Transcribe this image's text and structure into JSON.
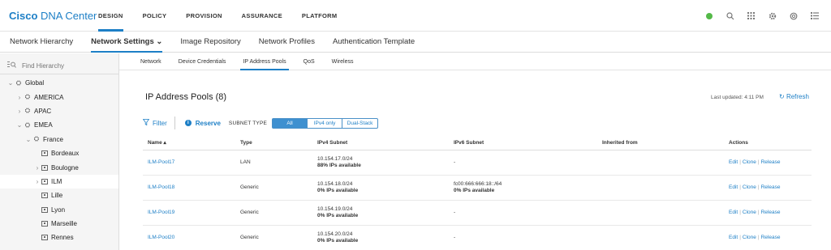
{
  "app": {
    "brand_bold": "Cisco",
    "brand_rest": " DNA Center",
    "topnav": [
      "DESIGN",
      "POLICY",
      "PROVISION",
      "ASSURANCE",
      "PLATFORM"
    ],
    "active_topnav": "DESIGN",
    "icons": [
      "status-icon",
      "search-icon",
      "apps-grid-icon",
      "gear-icon",
      "help-icon",
      "menu-icon"
    ],
    "colors": {
      "accent": "#1d7fc6",
      "status_ok": "#54b948"
    }
  },
  "subnav": {
    "items": [
      "Network Hierarchy",
      "Network Settings ⌄",
      "Image Repository",
      "Network Profiles",
      "Authentication Template"
    ]
  },
  "sidebar": {
    "search_placeholder": "Find Hierarchy",
    "tree": [
      {
        "label": "Global",
        "chev": "⌄",
        "icon": "globe"
      },
      {
        "label": "AMERICA",
        "chev": "›",
        "icon": "globe"
      },
      {
        "label": "APAC",
        "chev": "›",
        "icon": "globe"
      },
      {
        "label": "EMEA",
        "chev": "⌄",
        "icon": "globe"
      },
      {
        "label": "France",
        "chev": "⌄",
        "icon": "globe"
      },
      {
        "label": "Bordeaux",
        "chev": "",
        "icon": "building"
      },
      {
        "label": "Boulogne",
        "chev": "›",
        "icon": "building"
      },
      {
        "label": "ILM",
        "chev": "›",
        "icon": "building"
      },
      {
        "label": "Lille",
        "chev": "",
        "icon": "building"
      },
      {
        "label": "Lyon",
        "chev": "",
        "icon": "building"
      },
      {
        "label": "Marseille",
        "chev": "",
        "icon": "building"
      },
      {
        "label": "Rennes",
        "chev": "",
        "icon": "building"
      }
    ]
  },
  "tabs": [
    "Network",
    "Device Credentials",
    "IP Address Pools",
    "QoS",
    "Wireless"
  ],
  "pools": {
    "title": "IP Address Pools (8)",
    "last_updated": "Last updated: 4:11 PM",
    "refresh_label": "Refresh",
    "filter_label": "Filter",
    "reserve_label": "Reserve",
    "subnet_type_label": "SUBNET TYPE",
    "subnet_options": [
      "All",
      "IPv4 only",
      "Dual-Stack"
    ],
    "selected_subnet_option": "All",
    "columns": [
      "Name ▴",
      "Type",
      "IPv4 Subnet",
      "IPv6 Subnet",
      "Inherited from",
      "Actions"
    ],
    "rows": [
      {
        "name": "ILM-Pool17",
        "type": "LAN",
        "ipv4": "10.154.17.0/24",
        "ipv4_avail": "88% IPs available",
        "ipv6": "-",
        "ipv6_avail": "",
        "inherited": "",
        "actions": [
          "Edit",
          "Clone",
          "Release"
        ]
      },
      {
        "name": "ILM-Pool18",
        "type": "Generic",
        "ipv4": "10.154.18.0/24",
        "ipv4_avail": "0% IPs available",
        "ipv6": "fc00:666:666:18::/64",
        "ipv6_avail": "0% IPs available",
        "inherited": "",
        "actions": [
          "Edit",
          "Clone",
          "Release"
        ]
      },
      {
        "name": "ILM-Pool19",
        "type": "Generic",
        "ipv4": "10.154.19.0/24",
        "ipv4_avail": "0% IPs available",
        "ipv6": "-",
        "ipv6_avail": "",
        "inherited": "",
        "actions": [
          "Edit",
          "Clone",
          "Release"
        ]
      },
      {
        "name": "ILM-Pool20",
        "type": "Generic",
        "ipv4": "10.154.20.0/24",
        "ipv4_avail": "0% IPs available",
        "ipv6": "-",
        "ipv6_avail": "",
        "inherited": "",
        "actions": [
          "Edit",
          "Clone",
          "Release"
        ]
      }
    ]
  }
}
